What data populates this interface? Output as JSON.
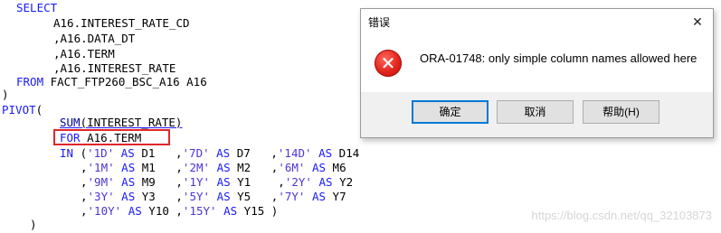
{
  "editor": {
    "l1": "SELECT",
    "l2": "A16.INTEREST_RATE_CD",
    "l3": ",A16.DATA_DT",
    "l4": ",A16.TERM",
    "l5": ",A16.INTEREST_RATE",
    "l6_kw": "FROM",
    "l6_rest": " FACT_FTP260_BSC_A16 A16",
    "l7": ")",
    "l8_kw": "PIVOT",
    "l8_rest": "(",
    "l9_fn": "SUM",
    "l9_rest": "(INTEREST_RATE)",
    "l10_kw": "FOR",
    "l10_rest": " A16.TERM",
    "l11": [
      {
        "t": "IN",
        "c": "kw"
      },
      {
        "t": " (",
        "c": ""
      },
      {
        "t": "'1D'",
        "c": "str"
      },
      {
        "t": " ",
        "c": ""
      },
      {
        "t": "AS",
        "c": "kw"
      },
      {
        "t": " D1   ,",
        "c": ""
      },
      {
        "t": "'7D'",
        "c": "str"
      },
      {
        "t": " ",
        "c": ""
      },
      {
        "t": "AS",
        "c": "kw"
      },
      {
        "t": " D7   ,",
        "c": ""
      },
      {
        "t": "'14D'",
        "c": "str"
      },
      {
        "t": " ",
        "c": ""
      },
      {
        "t": "AS",
        "c": "kw"
      },
      {
        "t": " D14",
        "c": ""
      }
    ],
    "l12": [
      {
        "t": ",",
        "c": ""
      },
      {
        "t": "'1M'",
        "c": "str"
      },
      {
        "t": " ",
        "c": ""
      },
      {
        "t": "AS",
        "c": "kw"
      },
      {
        "t": " M1   ,",
        "c": ""
      },
      {
        "t": "'2M'",
        "c": "str"
      },
      {
        "t": " ",
        "c": ""
      },
      {
        "t": "AS",
        "c": "kw"
      },
      {
        "t": " M2   ,",
        "c": ""
      },
      {
        "t": "'6M'",
        "c": "str"
      },
      {
        "t": " ",
        "c": ""
      },
      {
        "t": "AS",
        "c": "kw"
      },
      {
        "t": " M6",
        "c": ""
      }
    ],
    "l13": [
      {
        "t": ",",
        "c": ""
      },
      {
        "t": "'9M'",
        "c": "str"
      },
      {
        "t": " ",
        "c": ""
      },
      {
        "t": "AS",
        "c": "kw"
      },
      {
        "t": " M9   ,",
        "c": ""
      },
      {
        "t": "'1Y'",
        "c": "str"
      },
      {
        "t": " ",
        "c": ""
      },
      {
        "t": "AS",
        "c": "kw"
      },
      {
        "t": " Y1    ,",
        "c": ""
      },
      {
        "t": "'2Y'",
        "c": "str"
      },
      {
        "t": " ",
        "c": ""
      },
      {
        "t": "AS",
        "c": "kw"
      },
      {
        "t": " Y2",
        "c": ""
      }
    ],
    "l14": [
      {
        "t": ",",
        "c": ""
      },
      {
        "t": "'3Y'",
        "c": "str"
      },
      {
        "t": " ",
        "c": ""
      },
      {
        "t": "AS",
        "c": "kw"
      },
      {
        "t": " Y3   ,",
        "c": ""
      },
      {
        "t": "'5Y'",
        "c": "str"
      },
      {
        "t": " ",
        "c": ""
      },
      {
        "t": "AS",
        "c": "kw"
      },
      {
        "t": " Y5   ,",
        "c": ""
      },
      {
        "t": "'7Y'",
        "c": "str"
      },
      {
        "t": " ",
        "c": ""
      },
      {
        "t": "AS",
        "c": "kw"
      },
      {
        "t": " Y7",
        "c": ""
      }
    ],
    "l15": [
      {
        "t": ",",
        "c": ""
      },
      {
        "t": "'10Y'",
        "c": "str"
      },
      {
        "t": " ",
        "c": ""
      },
      {
        "t": "AS",
        "c": "kw"
      },
      {
        "t": " Y10 ,",
        "c": ""
      },
      {
        "t": "'15Y'",
        "c": "str"
      },
      {
        "t": " ",
        "c": ""
      },
      {
        "t": "AS",
        "c": "kw"
      },
      {
        "t": " Y15 )",
        "c": ""
      }
    ],
    "l16": ")"
  },
  "dialog": {
    "title": "错误",
    "close_glyph": "✕",
    "icon": "error-icon",
    "icon_glyph": "✕",
    "message": "ORA-01748: only simple column names allowed here",
    "buttons": {
      "ok": "确定",
      "cancel": "取消",
      "help": "帮助(H)"
    }
  },
  "watermark": "https://blog.csdn.net/qq_32103873",
  "colors": {
    "keyword": "#1a1aff",
    "string": "#4b36d4",
    "highlight": "#e0262a",
    "error": "#e2231a",
    "default_button_border": "#0078d7"
  }
}
